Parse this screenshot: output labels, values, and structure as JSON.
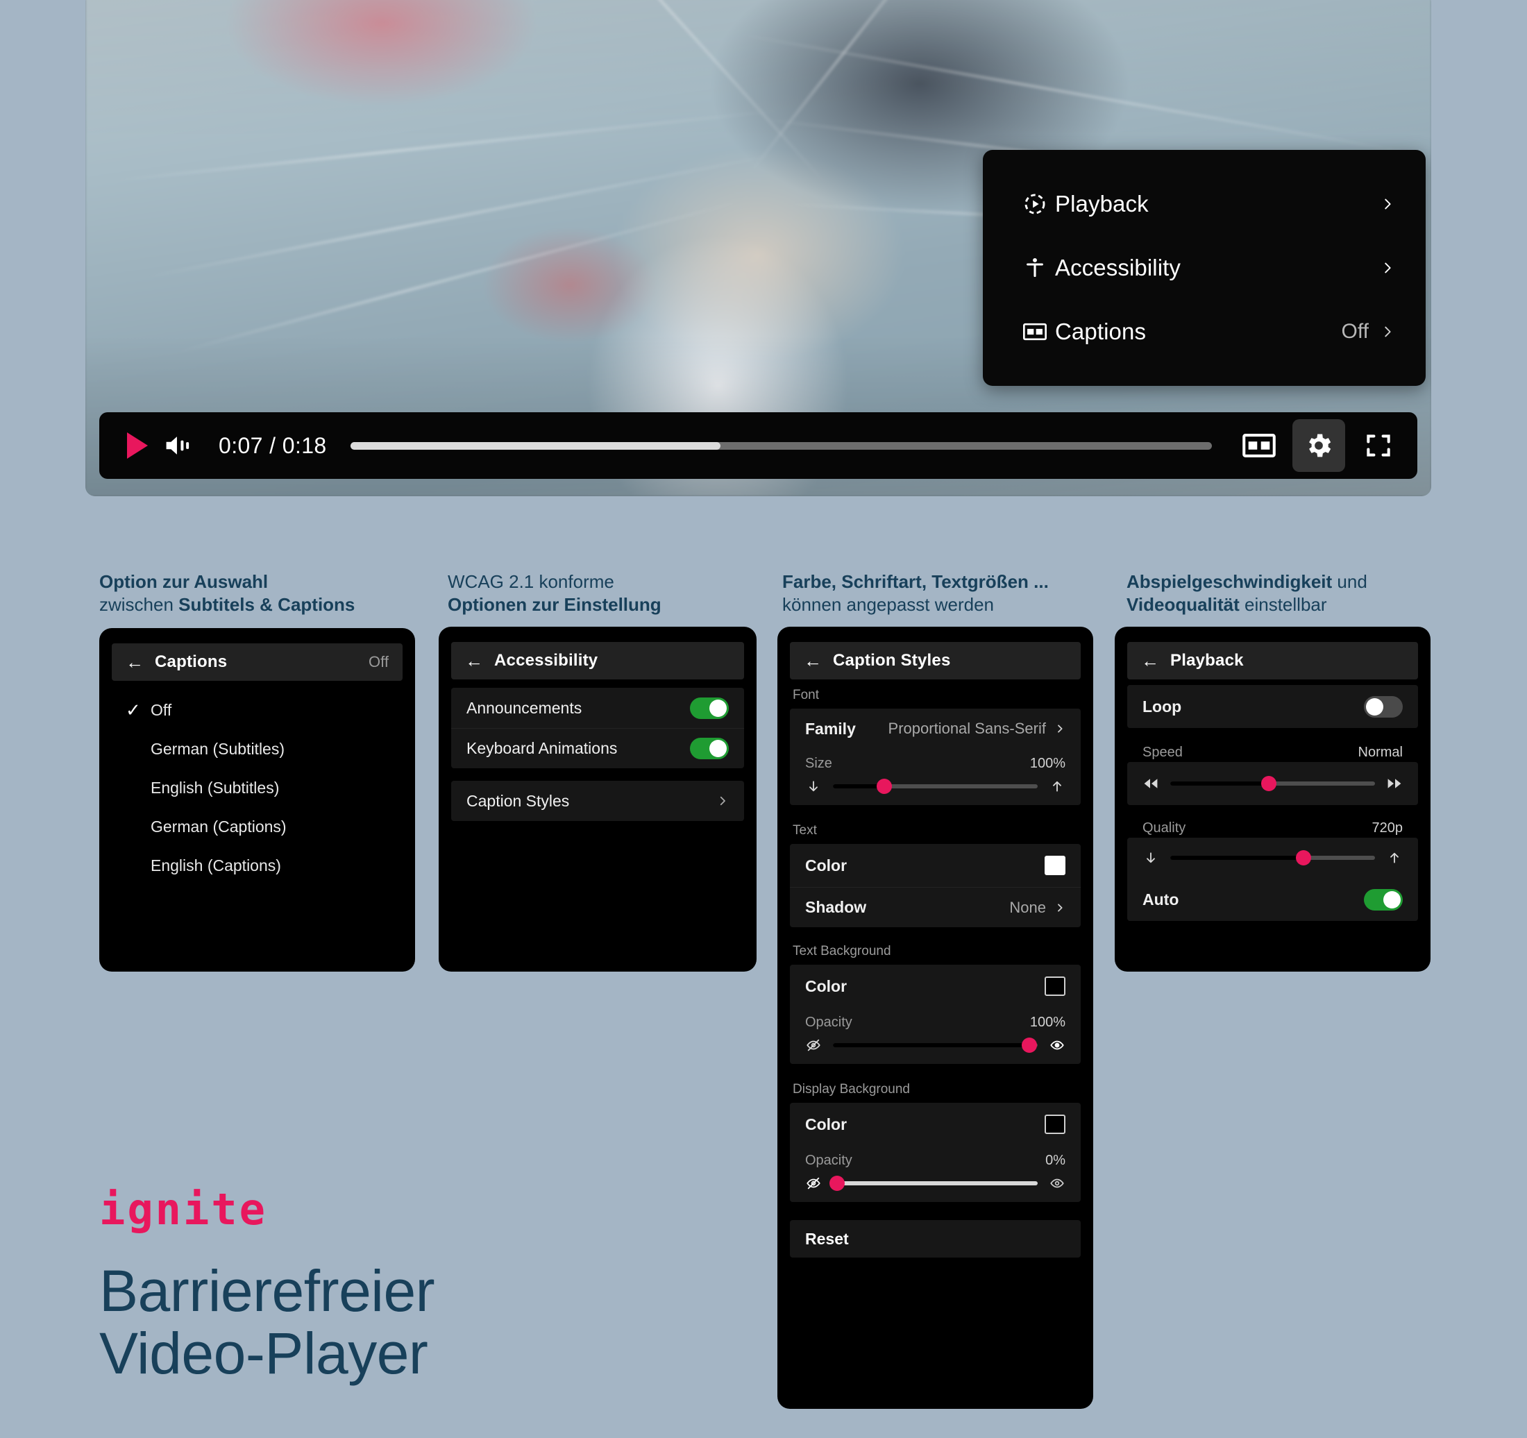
{
  "theme": {
    "page_background": "#a4b5c5",
    "accent_pink": "#e8175d",
    "toggle_green": "#1f9c32",
    "heading_blue": "#18405a",
    "panel_black": "#000000",
    "panel_row": "#171717",
    "panel_header": "#222222"
  },
  "player": {
    "controls": {
      "play_label": "Play",
      "volume_label": "Volume",
      "time_current": "0:07",
      "time_separator": "/",
      "time_total": "0:18",
      "time_display": "0:07 / 0:18",
      "progress_percent": 43,
      "captions_button_label": "CC",
      "settings_button_label": "Settings",
      "fullscreen_button_label": "Fullscreen"
    },
    "settings_menu": {
      "items": [
        {
          "label": "Playback",
          "icon": "playback-circle-icon",
          "value": "",
          "chevron": "›"
        },
        {
          "label": "Accessibility",
          "icon": "accessibility-person-icon",
          "value": "",
          "chevron": "›"
        },
        {
          "label": "Captions",
          "icon": "cc-icon",
          "value": "Off",
          "chevron": "›"
        }
      ]
    }
  },
  "sections": [
    {
      "heading_bold": "Option zur Auswahl",
      "heading_rest_plain": "zwischen ",
      "heading_rest_bold": "Subtitels & Captions",
      "panel": {
        "header_title": "Captions",
        "header_value": "Off",
        "back_arrow": "←",
        "options": [
          {
            "label": "Off",
            "checked": true
          },
          {
            "label": "German (Subtitles)",
            "checked": false
          },
          {
            "label": "English (Subtitles)",
            "checked": false
          },
          {
            "label": "German (Captions)",
            "checked": false
          },
          {
            "label": "English (Captions)",
            "checked": false
          }
        ],
        "check_glyph": "✓"
      }
    },
    {
      "heading_plain": "WCAG 2.1 konforme",
      "heading_bold": "Optionen zur Einstellung",
      "panel": {
        "header_title": "Accessibility",
        "back_arrow": "←",
        "toggles": [
          {
            "label": "Announcements",
            "state": "on"
          },
          {
            "label": "Keyboard Animations",
            "state": "on"
          }
        ],
        "link_row": {
          "label": "Caption Styles",
          "chevron": "›"
        }
      }
    },
    {
      "heading_bold": "Farbe, Schriftart, Textgrößen ...",
      "heading_plain": "können angepasst werden",
      "panel": {
        "header_title": "Caption Styles",
        "back_arrow": "←",
        "groups": [
          {
            "section_label": "Font",
            "rows": [
              {
                "type": "value",
                "label": "Family",
                "value": "Proportional Sans-Serif",
                "chevron": "›"
              }
            ],
            "slider": {
              "label": "Size",
              "value": "100%",
              "fill_percent": 25,
              "icon_left": "arrow-down-icon",
              "icon_right": "arrow-up-icon"
            }
          },
          {
            "section_label": "Text",
            "rows": [
              {
                "type": "swatch",
                "label": "Color",
                "swatch": "white"
              },
              {
                "type": "value",
                "label": "Shadow",
                "value": "None",
                "chevron": "›"
              }
            ]
          },
          {
            "section_label": "Text Background",
            "rows": [
              {
                "type": "swatch",
                "label": "Color",
                "swatch": "black"
              }
            ],
            "slider": {
              "label": "Opacity",
              "value": "100%",
              "fill_percent": 96,
              "icon_left": "eye-off-icon",
              "icon_right": "eye-icon"
            }
          },
          {
            "section_label": "Display Background",
            "rows": [
              {
                "type": "swatch",
                "label": "Color",
                "swatch": "black"
              }
            ],
            "slider": {
              "label": "Opacity",
              "value": "0%",
              "fill_percent": 2,
              "icon_left": "eye-off-icon",
              "icon_right": "eye-icon"
            }
          }
        ],
        "reset_label": "Reset"
      }
    },
    {
      "heading_bold": "Abspielgeschwindigkeit",
      "heading_plain": " und",
      "heading_bold2": "Videoqualität",
      "heading_plain2": " einstellbar",
      "panel": {
        "header_title": "Playback",
        "back_arrow": "←",
        "loop": {
          "label": "Loop",
          "state": "off"
        },
        "speed": {
          "label": "Speed",
          "value": "Normal",
          "fill_percent": 48,
          "icon_left": "rewind-icon",
          "icon_right": "fast-forward-icon"
        },
        "quality": {
          "label": "Quality",
          "value": "720p",
          "fill_percent": 65,
          "icon_left": "arrow-down-icon",
          "icon_right": "arrow-up-icon"
        },
        "auto": {
          "label": "Auto",
          "state": "on"
        }
      }
    }
  ],
  "brand": {
    "logo_text": "ignite",
    "title_line1": "Barrierefreier",
    "title_line2": "Video-Player"
  }
}
